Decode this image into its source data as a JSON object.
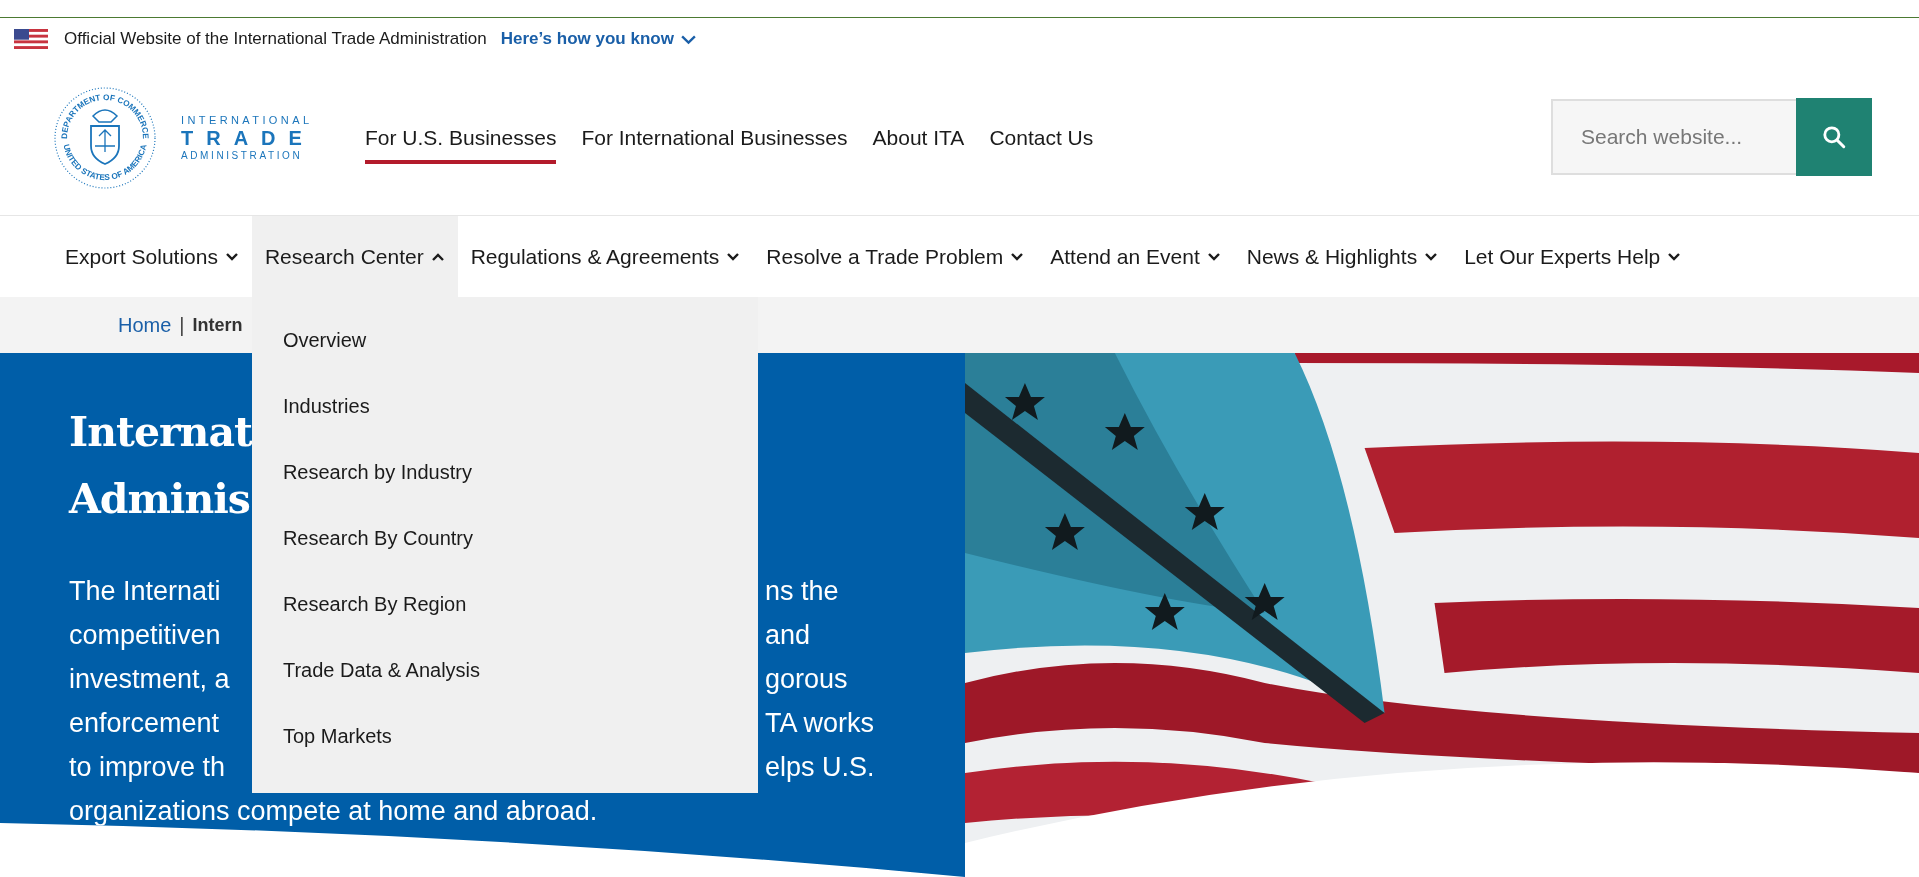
{
  "banner": {
    "text": "Official Website of the International Trade Administration",
    "link": "Here’s how you know"
  },
  "logo": {
    "seal_top": "DEPARTMENT OF COMMERCE",
    "seal_bottom": "UNITED STATES OF AMERICA",
    "line_1": "INTERNATIONAL",
    "line_2": "TRADE",
    "line_3": "ADMINISTRATION"
  },
  "top_nav": [
    {
      "label": "For U.S. Businesses",
      "selected": true
    },
    {
      "label": "For International Businesses",
      "selected": false
    },
    {
      "label": "About ITA",
      "selected": false
    },
    {
      "label": "Contact Us",
      "selected": false
    }
  ],
  "search": {
    "placeholder": "Search website..."
  },
  "main_nav": [
    {
      "label": "Export Solutions",
      "expanded": false
    },
    {
      "label": "Research Center",
      "expanded": true
    },
    {
      "label": "Regulations & Agreements",
      "expanded": false
    },
    {
      "label": "Resolve a Trade Problem",
      "expanded": false
    },
    {
      "label": "Attend an Event",
      "expanded": false
    },
    {
      "label": "News & Highlights",
      "expanded": false
    },
    {
      "label": "Let Our Experts Help",
      "expanded": false
    }
  ],
  "dropdown": {
    "items": [
      "Overview",
      "Industries",
      "Research by Industry",
      "Research By Country",
      "Research By Region",
      "Trade Data & Analysis",
      "Top Markets"
    ]
  },
  "breadcrumb": {
    "home": "Home",
    "separator": "|",
    "current": "Intern"
  },
  "hero": {
    "title_lines": [
      "Internat",
      "Adminis"
    ],
    "paragraph_lines": [
      {
        "left": "The Internati",
        "right": "ns the"
      },
      {
        "left": "competitiven",
        "right": "and"
      },
      {
        "left": "investment, a",
        "right": "gorous"
      },
      {
        "left": "enforcement",
        "right": "TA works"
      },
      {
        "left": "to improve th",
        "right": "elps U.S."
      },
      {
        "left": "organizations compete at home and abroad."
      }
    ]
  }
}
